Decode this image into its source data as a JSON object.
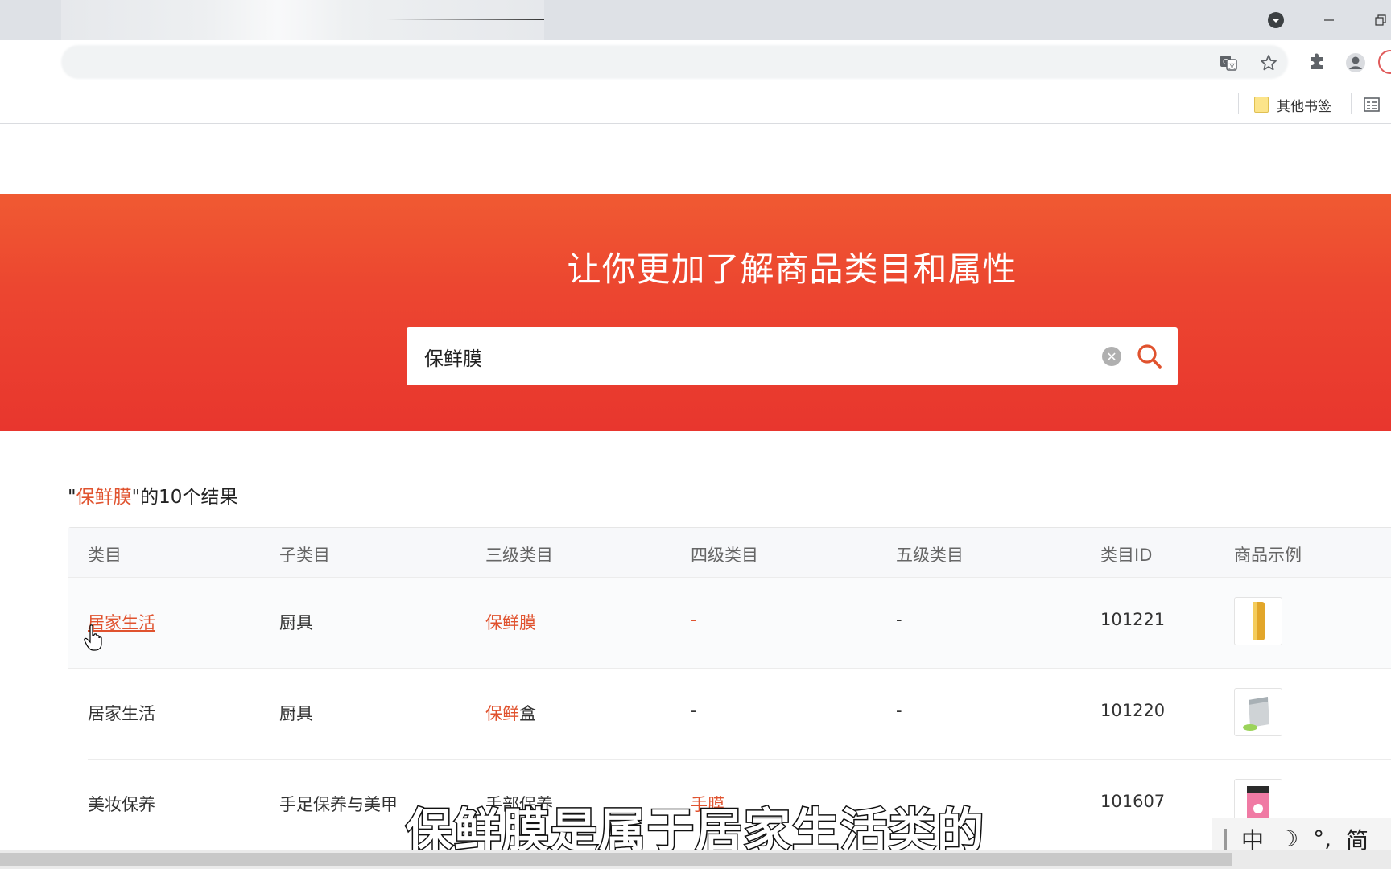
{
  "browser": {
    "bookmark_folder": "其他书签",
    "icons": [
      "translate-icon",
      "star-icon",
      "extension-icon",
      "profile-icon",
      "reading-list-icon"
    ]
  },
  "hero": {
    "title": "让你更加了解商品类目和属性",
    "search_value": "保鲜膜",
    "accent_color": "#e8362e"
  },
  "results": {
    "quote_open": "\"",
    "keyword": "保鲜膜",
    "suffix": "\"的10个结果"
  },
  "table": {
    "headers": [
      "类目",
      "子类目",
      "三级类目",
      "四级类目",
      "五级类目",
      "类目ID",
      "商品示例"
    ],
    "rows": [
      {
        "cat": "居家生活",
        "sub": "厨具",
        "l3_hl": "保鲜膜",
        "l3_rest": "",
        "l4": "-",
        "l5": "-",
        "id": "101221"
      },
      {
        "cat": "居家生活",
        "sub": "厨具",
        "l3_hl": "保鲜",
        "l3_rest": "盒",
        "l4": "-",
        "l5": "-",
        "id": "101220"
      },
      {
        "cat": "美妆保养",
        "sub": "手足保养与美甲",
        "l3_hl": "",
        "l3_rest": "手部保养",
        "l4": "手膜",
        "l5": "",
        "id": "101607"
      }
    ]
  },
  "subtitle": "保鲜膜是属于居家生活类的",
  "ime": {
    "mode": "中",
    "punct": "°,",
    "script": "简"
  }
}
